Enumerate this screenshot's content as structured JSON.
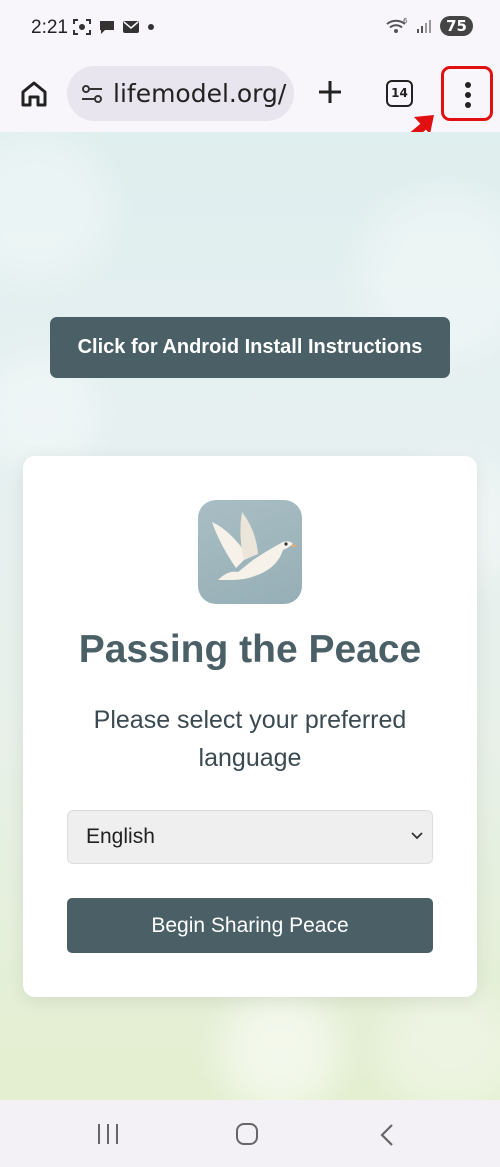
{
  "status_bar": {
    "time": "2:21",
    "battery": "75"
  },
  "browser": {
    "url": "lifemodel.org/",
    "tab_count": "14"
  },
  "page": {
    "android_button_label": "Click for Android Install Instructions",
    "card": {
      "title": "Passing the Peace",
      "subtitle": "Please select your preferred language",
      "language_selected": "English",
      "begin_button_label": "Begin Sharing Peace"
    }
  },
  "colors": {
    "accent": "#4b6066",
    "highlight": "#e01010"
  }
}
